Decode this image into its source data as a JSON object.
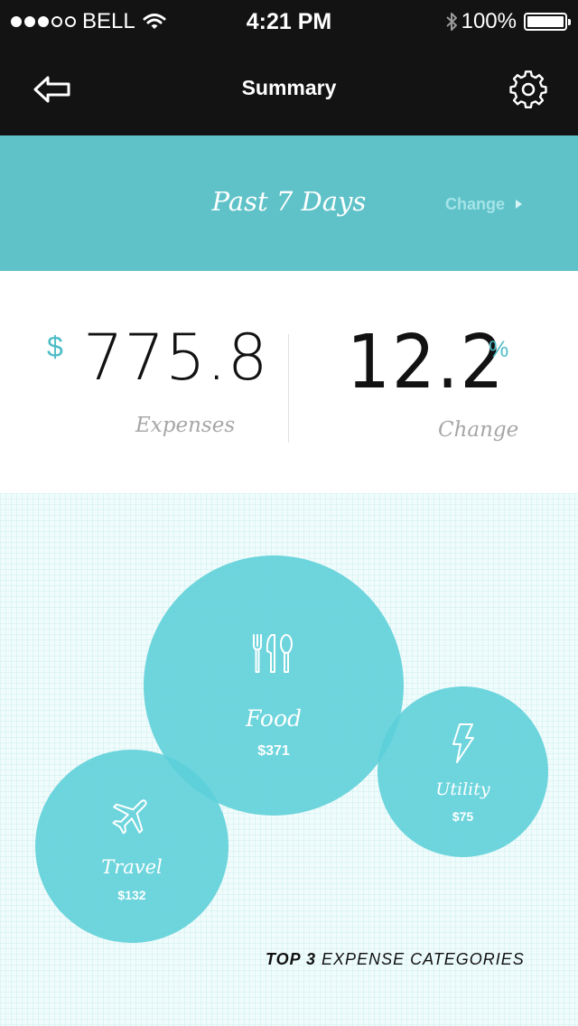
{
  "status_bar": {
    "carrier": "BELL",
    "time": "4:21 PM",
    "battery": "100%",
    "signal_bars_filled": 3,
    "signal_bars_total": 5
  },
  "nav": {
    "title": "Summary",
    "back_icon": "back-arrow-icon",
    "settings_icon": "gear-icon"
  },
  "period": {
    "label": "Past 7 Days",
    "change_link": "Change"
  },
  "stats": {
    "currency_symbol": "$",
    "expenses_value": "775.8",
    "expenses_label": "Expenses",
    "change_value": "12.2",
    "change_unit": "%",
    "change_label": "Change"
  },
  "categories": [
    {
      "name": "Food",
      "amount": "$371",
      "icon": "cutlery-icon"
    },
    {
      "name": "Travel",
      "amount": "$132",
      "icon": "airplane-icon"
    },
    {
      "name": "Utility",
      "amount": "$75",
      "icon": "lightning-icon"
    }
  ],
  "caption": {
    "strong": "TOP 3",
    "rest": "EXPENSE CATEGORIES"
  },
  "colors": {
    "accent": "#5fc2c8",
    "bubble": "#5bcfd8",
    "bar": "#131313"
  }
}
